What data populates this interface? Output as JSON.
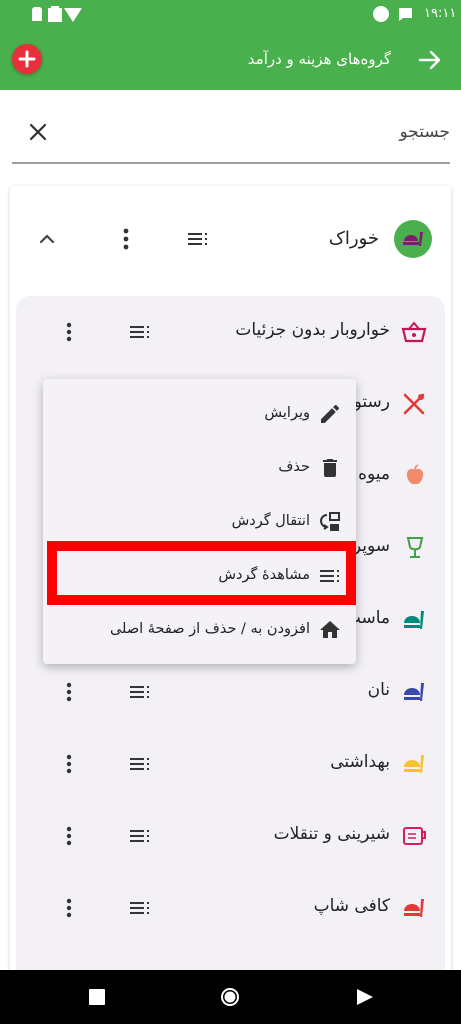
{
  "status_bar": {
    "time": "۱۹:۱۱"
  },
  "app_bar": {
    "title": "گروه‌های هزینه و درآمد"
  },
  "search": {
    "placeholder": "جستجو"
  },
  "group": {
    "name": "خوراک"
  },
  "rows": [
    {
      "label": "خواروبار بدون جزئیات"
    },
    {
      "label": "رستوران"
    },
    {
      "label": "میوه"
    },
    {
      "label": "سوپرمارکت"
    },
    {
      "label": "ماست"
    },
    {
      "label": "نان"
    },
    {
      "label": "بهداشتی"
    },
    {
      "label": "شیرینی و تنقلات"
    },
    {
      "label": "کافی شاپ"
    }
  ],
  "menu": {
    "items": [
      {
        "label": "ویرایش",
        "icon": "pencil-icon"
      },
      {
        "label": "حذف",
        "icon": "trash-icon"
      },
      {
        "label": "انتقال گردش",
        "icon": "transfer-icon"
      },
      {
        "label": "مشاهدهٔ گردش",
        "icon": "list-icon"
      },
      {
        "label": "افزودن به / حذف از صفحهٔ اصلی",
        "icon": "home-icon"
      }
    ]
  },
  "colors": {
    "primary": "#49b04d",
    "add_button": "#e8303c",
    "highlight": "#ff0000"
  }
}
